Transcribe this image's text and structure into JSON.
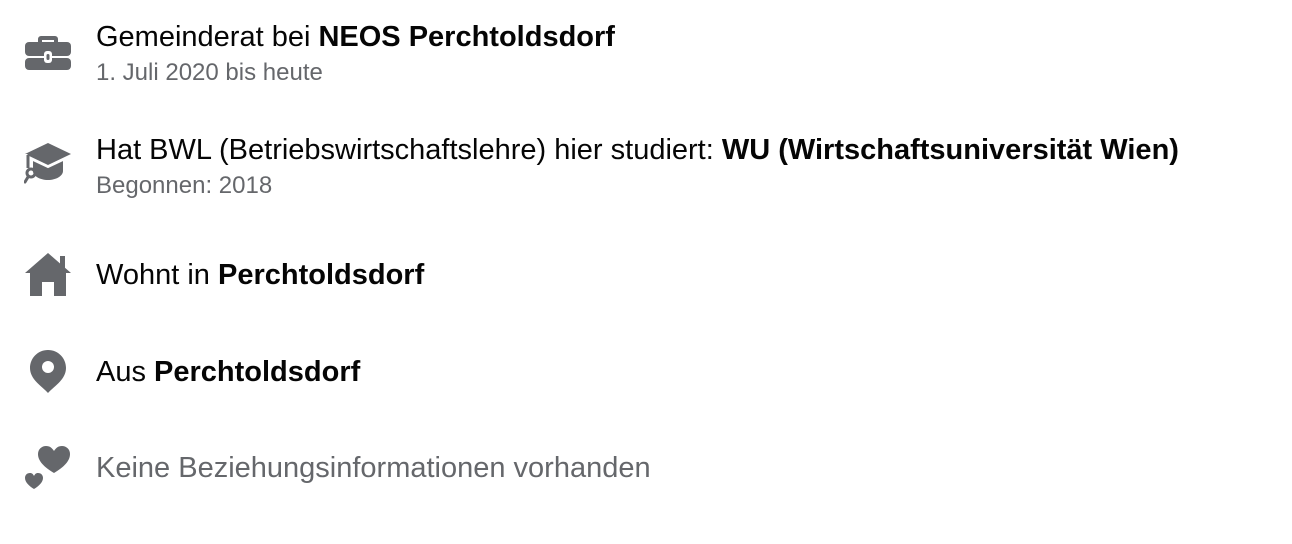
{
  "colors": {
    "icon": "#65676b",
    "text_primary": "#050505",
    "text_secondary": "#65676b"
  },
  "rows": [
    {
      "icon": "briefcase-icon",
      "prefix": "Gemeinderat bei ",
      "bold": "NEOS Perchtoldsdorf",
      "sub": "1. Juli 2020 bis heute"
    },
    {
      "icon": "graduation-cap-icon",
      "prefix": "Hat BWL (Betriebswirtschaftslehre) hier studiert: ",
      "bold": "WU (Wirtschaftsuniversität Wien)",
      "sub": "Begonnen: 2018"
    },
    {
      "icon": "home-icon",
      "prefix": "Wohnt in ",
      "bold": "Perchtoldsdorf"
    },
    {
      "icon": "location-pin-icon",
      "prefix": "Aus ",
      "bold": "Perchtoldsdorf"
    },
    {
      "icon": "hearts-icon",
      "text": "Keine Beziehungsinformationen vorhanden"
    }
  ]
}
